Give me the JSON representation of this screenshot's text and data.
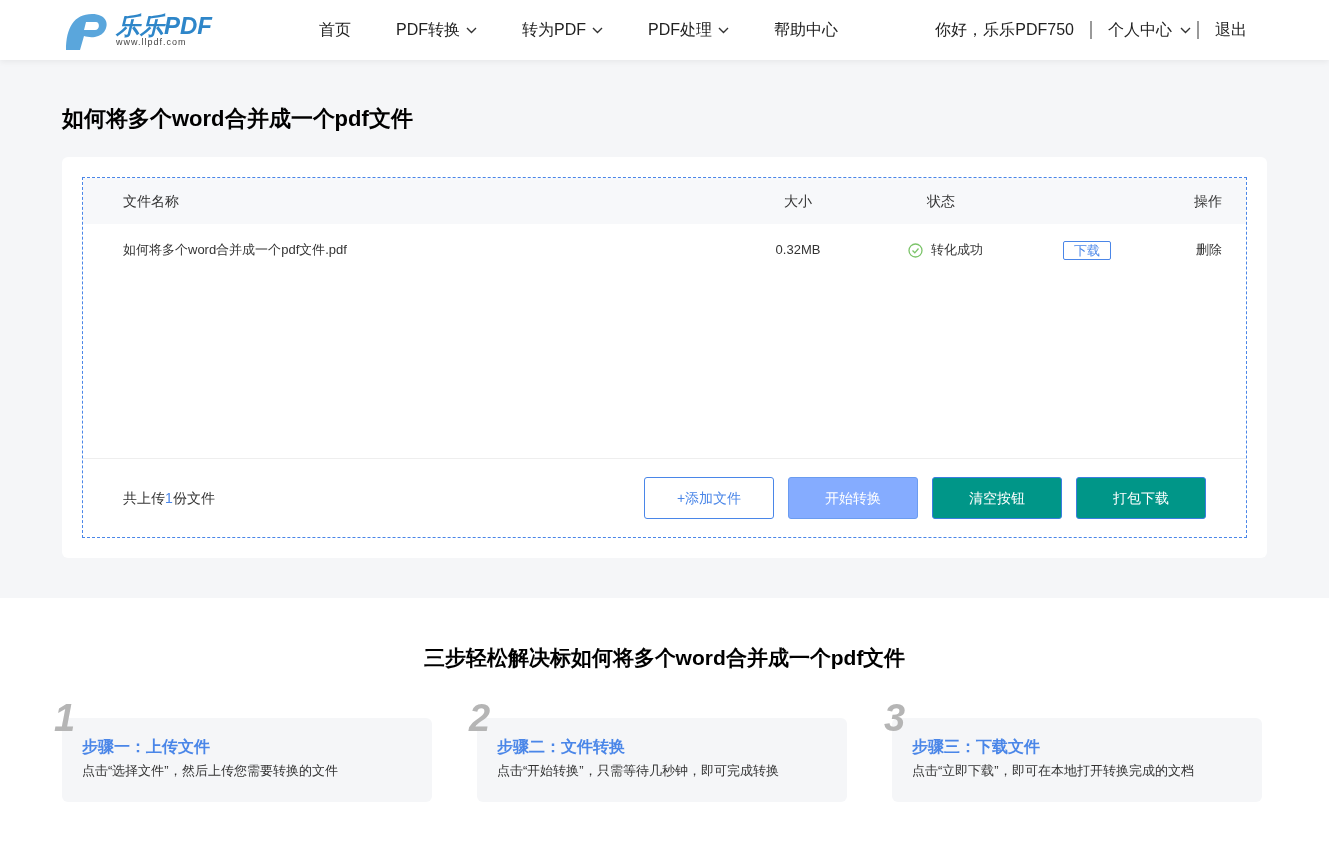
{
  "header": {
    "brand": "乐乐PDF",
    "site": "www.llpdf.com",
    "nav": [
      {
        "label": "首页",
        "dropdown": false
      },
      {
        "label": "PDF转换",
        "dropdown": true
      },
      {
        "label": "转为PDF",
        "dropdown": true
      },
      {
        "label": "PDF处理",
        "dropdown": true
      },
      {
        "label": "帮助中心",
        "dropdown": false
      }
    ],
    "greeting": "你好，乐乐PDF750",
    "account": "个人中心",
    "logout": "退出"
  },
  "page_title": "如何将多个word合并成一个pdf文件",
  "table": {
    "columns": [
      "文件名称",
      "大小",
      "状态",
      "操作"
    ],
    "rows": [
      {
        "name": "如何将多个word合并成一个pdf文件.pdf",
        "size": "0.32MB",
        "status": "转化成功",
        "success": true,
        "download": "下载",
        "delete": "删除"
      }
    ]
  },
  "summary": {
    "before": "共上传",
    "count": "1",
    "after": "份文件"
  },
  "buttons": [
    {
      "label": "+添加文件",
      "kind": "outline"
    },
    {
      "label": "开始转换",
      "kind": "disabled"
    },
    {
      "label": "清空按钮",
      "kind": "primary"
    },
    {
      "label": "打包下载",
      "kind": "primary"
    }
  ],
  "steps_title": "三步轻松解决标如何将多个word合并成一个pdf文件",
  "steps": [
    {
      "number": "1",
      "title": "步骤一：上传文件",
      "text": "点击“选择文件”，然后上传您需要转换的文件"
    },
    {
      "number": "2",
      "title": "步骤二：文件转换",
      "text": "点击“开始转换”，只需等待几秒钟，即可完成转换"
    },
    {
      "number": "3",
      "title": "步骤三：下载文件",
      "text": "点击“立即下载”，即可在本地打开转换完成的文档"
    }
  ]
}
